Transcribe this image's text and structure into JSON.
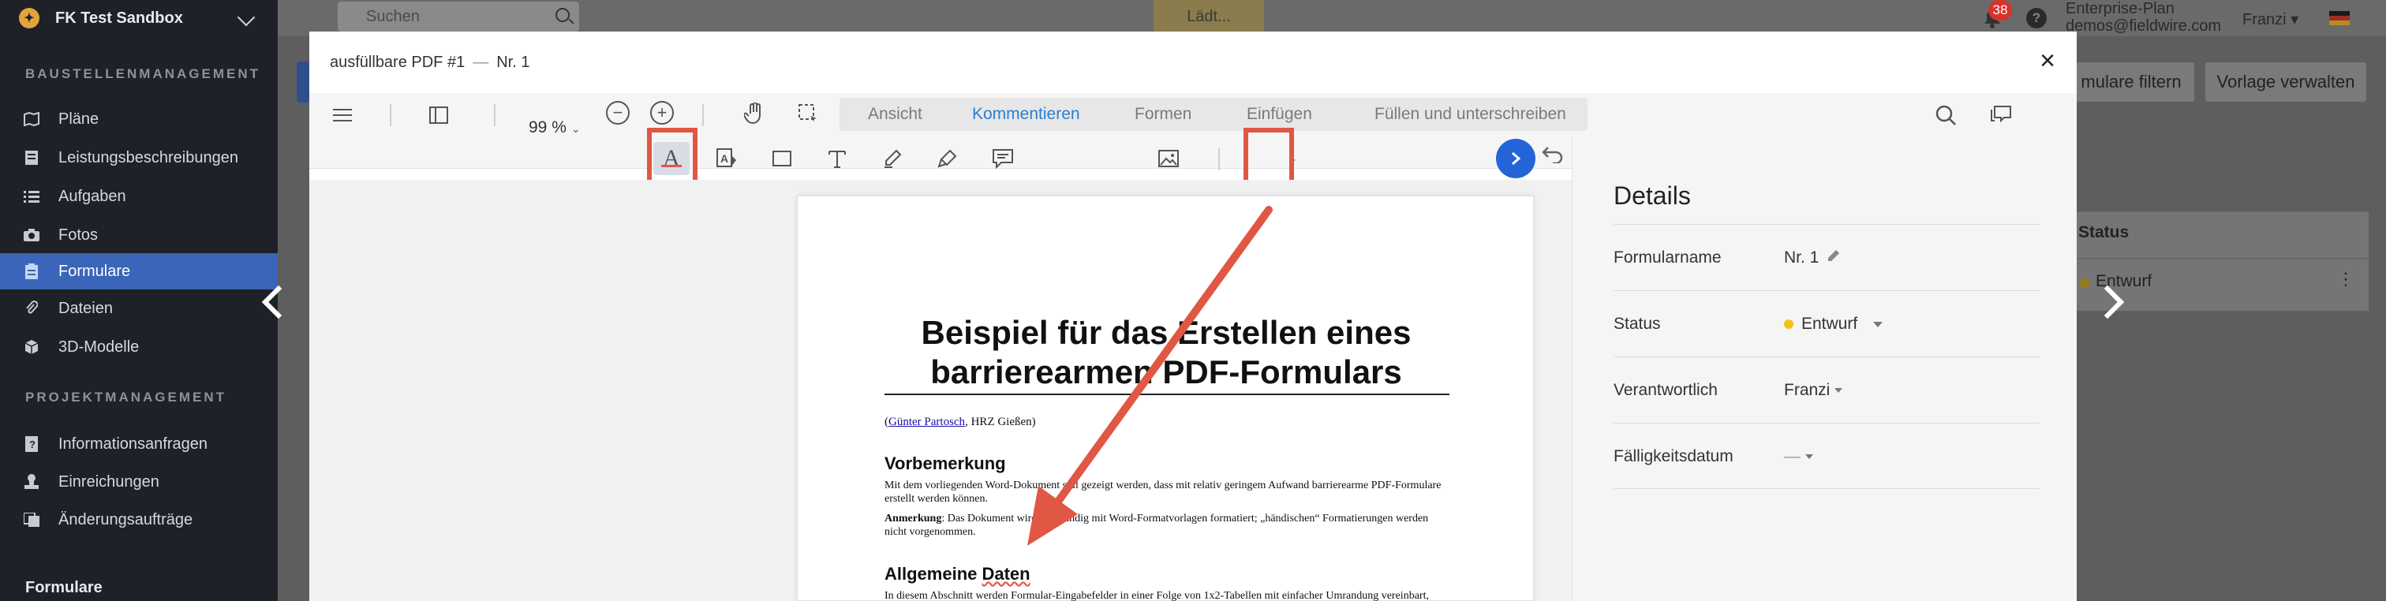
{
  "sidebar": {
    "org_name": "FK Test Sandbox",
    "section1": "BAUSTELLENMANAGEMENT",
    "items1": [
      {
        "label": "Pläne",
        "icon": "map-icon"
      },
      {
        "label": "Leistungsbeschreibungen",
        "icon": "doc-list-icon"
      },
      {
        "label": "Aufgaben",
        "icon": "list-icon"
      },
      {
        "label": "Fotos",
        "icon": "camera-icon"
      },
      {
        "label": "Formulare",
        "icon": "clipboard-icon",
        "active": true
      },
      {
        "label": "Dateien",
        "icon": "paperclip-icon"
      },
      {
        "label": "3D-Modelle",
        "icon": "cube-icon"
      }
    ],
    "section2": "PROJEKTMANAGEMENT",
    "items2": [
      {
        "label": "Informationsanfragen",
        "icon": "question-doc-icon"
      },
      {
        "label": "Einreichungen",
        "icon": "stamp-icon"
      },
      {
        "label": "Änderungsaufträge",
        "icon": "change-icon"
      }
    ],
    "bottom_label": "Formulare"
  },
  "topbar": {
    "search_placeholder": "Suchen",
    "loading": "Lädt...",
    "notification_count": "38",
    "help": "?",
    "plan_name": "Enterprise-Plan",
    "plan_email": "demos@fieldwire.com",
    "user_name": "Franzi ▾"
  },
  "background": {
    "filter_button": "mulare filtern",
    "template_button": "Vorlage verwalten",
    "table_header": "Status",
    "table_value": "Entwurf",
    "kebab": "⋮"
  },
  "modal": {
    "title": "ausfüllbare PDF #1",
    "separator": "—",
    "subtitle": "Nr. 1",
    "close": "×",
    "zoom": "99 %",
    "zoom_out": "−",
    "zoom_in": "+",
    "tabs": [
      {
        "label": "Ansicht"
      },
      {
        "label": "Kommentieren",
        "active": true
      },
      {
        "label": "Formen"
      },
      {
        "label": "Einfügen"
      },
      {
        "label": "Füllen und unterschreiben"
      }
    ],
    "colors": {
      "highlight_red": "#e05744",
      "blue": "#2b7fd3",
      "green": "#3aa05a"
    }
  },
  "document": {
    "title_line1": "Beispiel für das Erstellen eines",
    "title_line2": "barrierearmen PDF-Formulars",
    "author_open": "(",
    "author_link": "Günter Partosch",
    "author_rest": ", HRZ Gießen)",
    "h1": "Vorbemerkung",
    "p1": "Mit dem vorliegenden Word-Dokument soll gezeigt werden, dass mit relativ geringem Aufwand barrierearme PDF-Formulare erstellt werden können.",
    "p2_bold": "Anmerkung",
    "p2": ": Das Dokument wird vollständig mit Word-Formatvorlagen formatiert; „händischen“ Formatierungen werden nicht vorgenommen.",
    "h2_a": "Allgemeine ",
    "h2_b": "Daten",
    "p3": "In diesem Abschnitt werden Formular-Eingabefelder in einer Folge von 1x2-Tabellen mit einfacher Umrandung vereinbart, wobei die jeweils erste Zelle der Beschreibung des Formularfelds dient und die zweite Zelle leer ist und das eigentliche Eingabefeld repräsentiert."
  },
  "details": {
    "title": "Details",
    "rows": [
      {
        "label": "Formularname",
        "value": "Nr. 1"
      },
      {
        "label": "Status",
        "value": "Entwurf"
      },
      {
        "label": "Verantwortlich",
        "value": "Franzi"
      },
      {
        "label": "Fälligkeitsdatum",
        "value": "—"
      }
    ]
  }
}
